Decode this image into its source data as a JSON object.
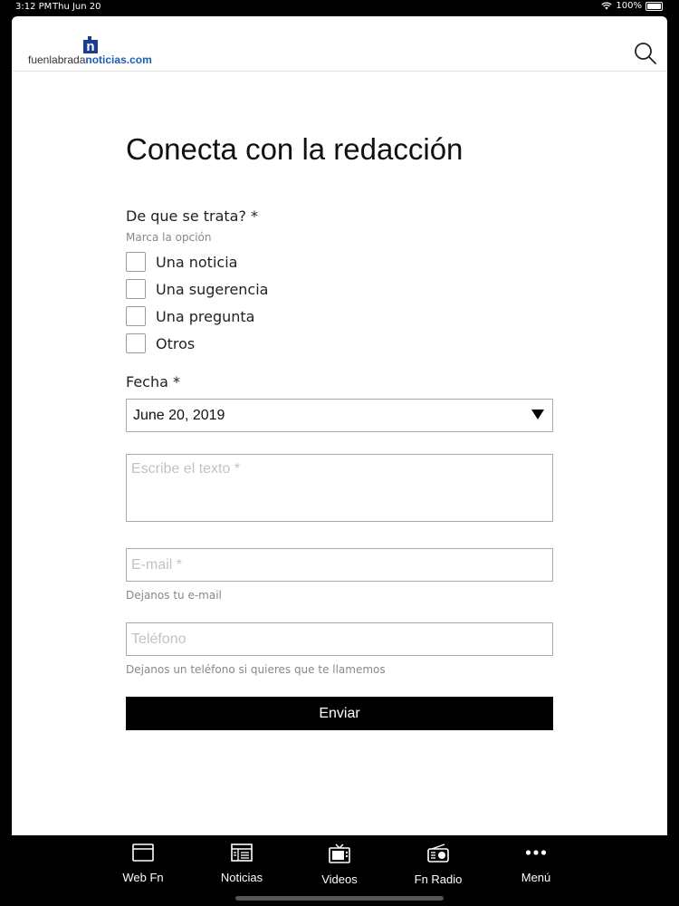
{
  "status_bar": {
    "time": "3:12 PM",
    "date": "Thu Jun 20",
    "battery": "100%"
  },
  "header": {
    "logo_part1": "fuenlabrada",
    "logo_part2": "noticias.com",
    "logo_mark": "n",
    "search_icon": "search-icon"
  },
  "form": {
    "title": "Conecta con la redacción",
    "topic_label": "De que se trata? *",
    "topic_hint": "Marca la opción",
    "options": [
      "Una noticia",
      "Una sugerencia",
      "Una pregunta",
      "Otros"
    ],
    "date_label": "Fecha *",
    "date_value": "June 20, 2019",
    "text_placeholder": "Escribe el texto *",
    "email_placeholder": "E-mail *",
    "email_hint": "Dejanos tu e-mail",
    "phone_placeholder": "Teléfono",
    "phone_hint": "Dejanos un teléfono si quieres que te llamemos",
    "submit_label": "Enviar"
  },
  "tabbar": {
    "items": [
      {
        "label": "Web Fn",
        "icon": "browser-window-icon"
      },
      {
        "label": "Noticias",
        "icon": "newspaper-icon"
      },
      {
        "label": "Videos",
        "icon": "tv-icon"
      },
      {
        "label": "Fn Radio",
        "icon": "radio-icon"
      },
      {
        "label": "Menú",
        "icon": "more-dots-icon"
      }
    ]
  },
  "colors": {
    "brand": "#1a5fb4",
    "brand_dark": "#1a3d8f",
    "button": "#000000"
  }
}
